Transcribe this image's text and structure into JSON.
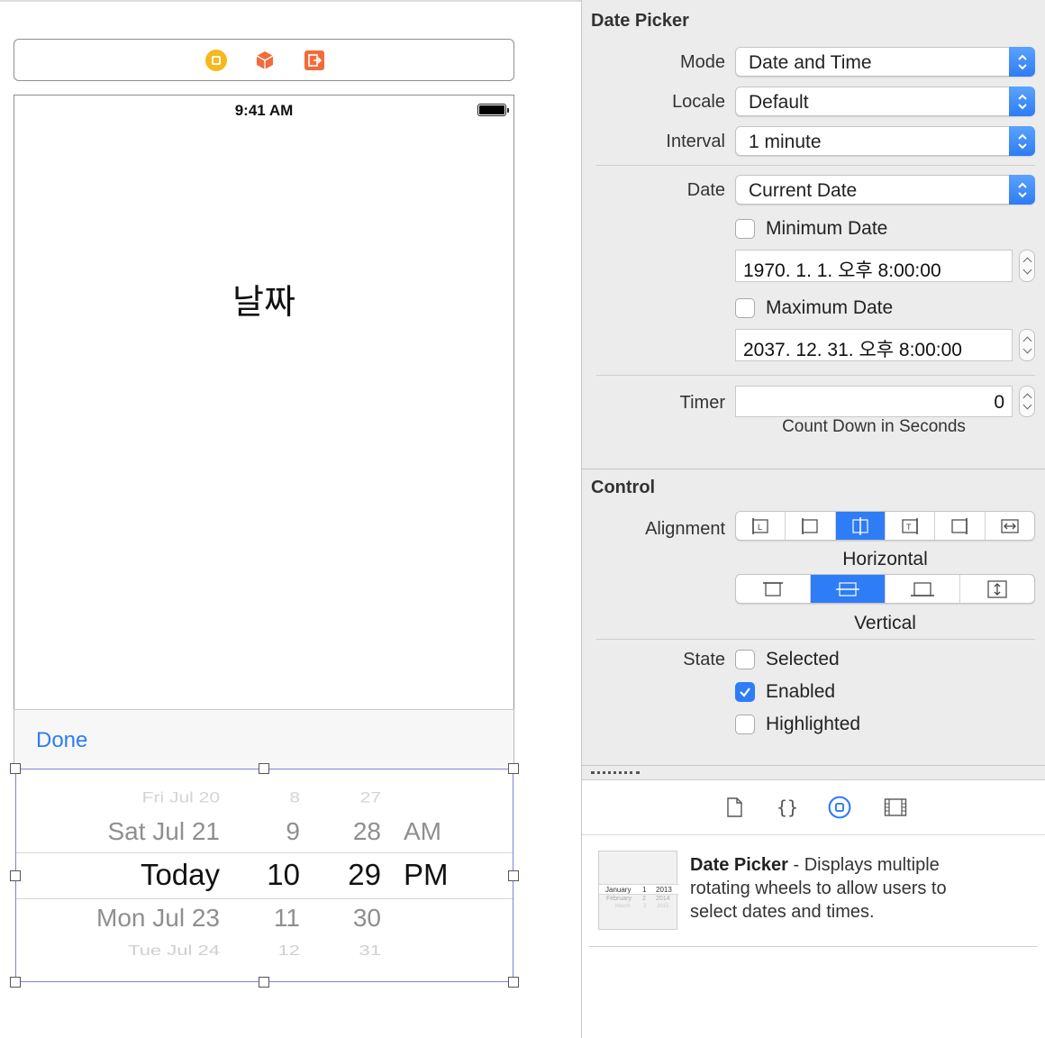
{
  "canvas": {
    "status_time": "9:41 AM",
    "main_label": "날짜",
    "done_label": "Done",
    "picker": {
      "dates": [
        "Fri Jul 20",
        "Sat Jul 21",
        "Today",
        "Mon Jul 23",
        "Tue Jul 24"
      ],
      "hours": [
        "8",
        "9",
        "10",
        "11",
        "12"
      ],
      "minutes": [
        "27",
        "28",
        "29",
        "30",
        "31"
      ],
      "ampm": [
        "AM",
        "PM"
      ]
    }
  },
  "inspector": {
    "date_picker": {
      "title": "Date Picker",
      "mode_label": "Mode",
      "mode_value": "Date and Time",
      "locale_label": "Locale",
      "locale_value": "Default",
      "interval_label": "Interval",
      "interval_value": "1 minute",
      "date_label": "Date",
      "date_value": "Current Date",
      "min_date_label": "Minimum Date",
      "min_date_value": "1970.  1.   1. 오후  8:00:00",
      "max_date_label": "Maximum Date",
      "max_date_value": "2037. 12. 31. 오후  8:00:00",
      "timer_label": "Timer",
      "timer_value": "0",
      "timer_caption": "Count Down in Seconds"
    },
    "control": {
      "title": "Control",
      "alignment_label": "Alignment",
      "horizontal_caption": "Horizontal",
      "vertical_caption": "Vertical",
      "state_label": "State",
      "selected_label": "Selected",
      "enabled_label": "Enabled",
      "highlighted_label": "Highlighted",
      "horizontal_selected_index": 2,
      "vertical_selected_index": 1,
      "selected_checked": false,
      "enabled_checked": true,
      "highlighted_checked": false
    },
    "library": {
      "title": "Date Picker",
      "description": " - Displays multiple rotating wheels to allow users to select dates and times.",
      "thumb_rows": [
        [
          "January",
          "1",
          "2013"
        ],
        [
          "February",
          "2",
          "2014"
        ],
        [
          "March",
          "3",
          "2015"
        ]
      ]
    }
  },
  "colors": {
    "accent": "#2e7cf6",
    "view_controller_icon": "#f6b81c",
    "exit_icon": "#f26b3a",
    "first_responder_icon": "#f26b3a"
  }
}
